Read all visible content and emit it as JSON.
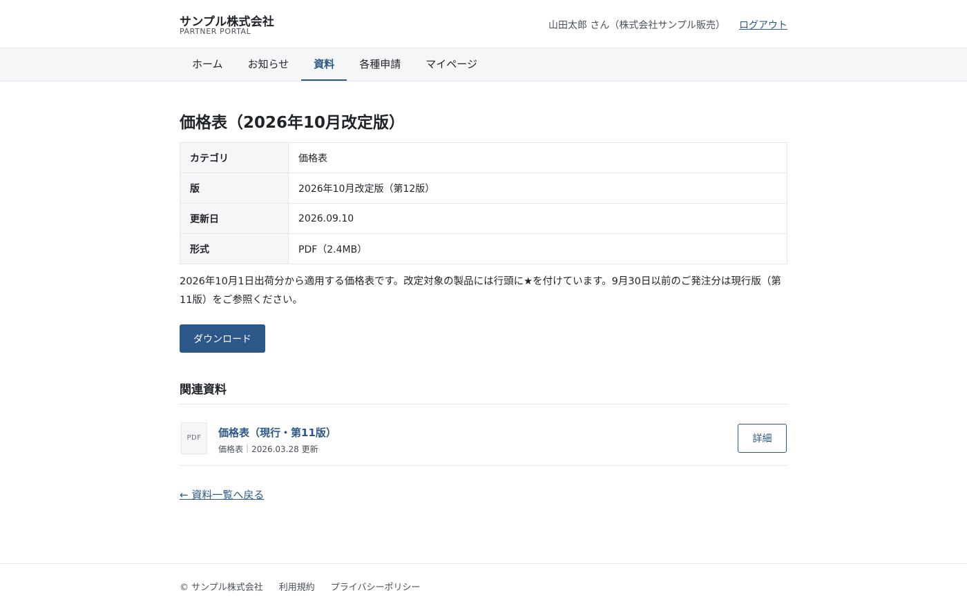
{
  "header": {
    "company": "サンプル株式会社",
    "subtitle": "PARTNER PORTAL",
    "user": "山田太郎 さん（株式会社サンプル販売）",
    "logout": "ログアウト"
  },
  "nav": {
    "tabs": [
      {
        "label": "ホーム"
      },
      {
        "label": "お知らせ"
      },
      {
        "label": "資料",
        "active": true
      },
      {
        "label": "各種申請"
      },
      {
        "label": "マイページ"
      }
    ]
  },
  "document": {
    "title": "価格表（2026年10月改定版）",
    "meta": [
      {
        "key": "カテゴリ",
        "value": "価格表"
      },
      {
        "key": "版",
        "value": "2026年10月改定版（第12版）"
      },
      {
        "key": "更新日",
        "value": "2026.09.10"
      },
      {
        "key": "形式",
        "value": "PDF（2.4MB）"
      }
    ],
    "description": "2026年10月1日出荷分から適用する価格表です。改定対象の製品には行頭に★を付けています。9月30日以前のご発注分は現行版（第11版）をご参照ください。",
    "download_label": "ダウンロード"
  },
  "related": {
    "heading": "関連資料",
    "items": [
      {
        "file_type": "PDF",
        "title": "価格表（現行・第11版）",
        "category": "価格表",
        "separator": "|",
        "updated": "2026.03.28 更新",
        "detail_label": "詳細"
      }
    ]
  },
  "back_link": "← 資料一覧へ戻る",
  "footer": {
    "copyright": "© サンプル株式会社",
    "links": [
      "利用規約",
      "プライバシーポリシー"
    ]
  },
  "colors": {
    "accent": "#2b5889",
    "border": "#e3e6ea",
    "muted_bg": "#f5f6f8"
  }
}
